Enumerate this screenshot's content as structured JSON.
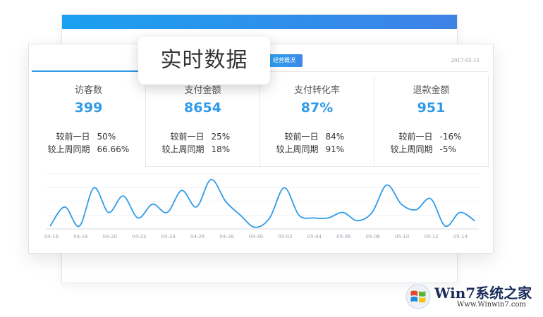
{
  "floating_label": "实时数据",
  "header": {
    "overview_button": "经营概况",
    "date": "2017-05-15"
  },
  "kpis": [
    {
      "title": "访客数",
      "value": "399",
      "compare": [
        {
          "label": "较前一日",
          "value": "50%"
        },
        {
          "label": "较上周同期",
          "value": "66.66%"
        }
      ]
    },
    {
      "title": "支付金额",
      "value": "8654",
      "compare": [
        {
          "label": "较前一日",
          "value": "25%"
        },
        {
          "label": "较上周同期",
          "value": "18%"
        }
      ]
    },
    {
      "title": "支付转化率",
      "value": "87%",
      "compare": [
        {
          "label": "较前一日",
          "value": "84%"
        },
        {
          "label": "较上周同期",
          "value": "91%"
        }
      ]
    },
    {
      "title": "退款金额",
      "value": "951",
      "compare": [
        {
          "label": "较前一日",
          "value": "-16%"
        },
        {
          "label": "较上周同期",
          "value": "-5%"
        }
      ]
    }
  ],
  "chart_data": {
    "type": "line",
    "title": "",
    "xlabel": "",
    "ylabel": "",
    "ylim": [
      0,
      10
    ],
    "grid": true,
    "tick_labels": [
      "04-16",
      "04-18",
      "04-20",
      "04-22",
      "04-24",
      "04-26",
      "04-28",
      "04-30",
      "05-02",
      "05-04",
      "05-06",
      "05-08",
      "05-10",
      "05-12",
      "05-14"
    ],
    "line_color": "#2f9be8",
    "series": [
      {
        "values": [
          0.5,
          4,
          0.5,
          7.5,
          3,
          6,
          2,
          4.5,
          3,
          7,
          4,
          9,
          5,
          2.5,
          0.3,
          2,
          7.5,
          2.5,
          2,
          2,
          3,
          1.5,
          3,
          8,
          4.5,
          3.5,
          5.5,
          0.5,
          3,
          1.5
        ]
      }
    ]
  },
  "watermark": {
    "title": "Win7系统之家",
    "url": "Www.Winwin7.com"
  },
  "colors": {
    "accent": "#2f9be8",
    "top_bar_start": "#1aa0f0",
    "top_bar_end": "#3f82e6"
  }
}
